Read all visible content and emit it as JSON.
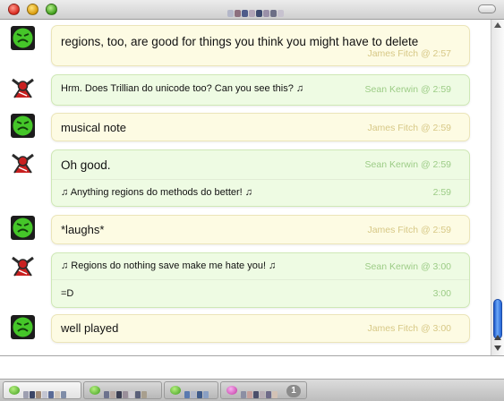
{
  "window": {
    "title_obscured": true
  },
  "messages": [
    {
      "sender": "James Fitch",
      "style": "outgoing",
      "avatar": "green-smiley-avatar",
      "lines": [
        {
          "text": "regions, too, are good for things you think you might have to delete",
          "stamp": "James Fitch @ 2:57"
        }
      ]
    },
    {
      "sender": "Sean Kerwin",
      "style": "incoming",
      "avatar": "red-beast-avatar",
      "lines": [
        {
          "text": "Hrm.  Does Trillian do unicode too?  Can you see this? ♫",
          "stamp": "Sean Kerwin @ 2:59"
        }
      ]
    },
    {
      "sender": "James Fitch",
      "style": "outgoing",
      "avatar": "green-smiley-avatar",
      "lines": [
        {
          "text": "musical note",
          "stamp": "James Fitch @ 2:59"
        }
      ]
    },
    {
      "sender": "Sean Kerwin",
      "style": "incoming",
      "avatar": "red-beast-avatar",
      "lines": [
        {
          "text": "Oh good.",
          "stamp": "Sean Kerwin @ 2:59"
        },
        {
          "text": "♫ Anything regions do methods do better! ♫",
          "stamp": "2:59"
        }
      ]
    },
    {
      "sender": "James Fitch",
      "style": "outgoing",
      "avatar": "green-smiley-avatar",
      "lines": [
        {
          "text": "*laughs*",
          "stamp": "James Fitch @ 2:59"
        }
      ]
    },
    {
      "sender": "Sean Kerwin",
      "style": "incoming",
      "avatar": "red-beast-avatar",
      "lines": [
        {
          "text": "♫ Regions do nothing save make me hate you! ♫",
          "stamp": "Sean Kerwin @ 3:00"
        },
        {
          "text": "=D",
          "stamp": "3:00"
        }
      ]
    },
    {
      "sender": "James Fitch",
      "style": "outgoing",
      "avatar": "green-smiley-avatar",
      "lines": [
        {
          "text": "well played",
          "stamp": "James Fitch @ 3:00"
        }
      ]
    }
  ],
  "input": {
    "value": "",
    "placeholder": ""
  },
  "tabs": [
    {
      "icon": "green-bubble-icon",
      "active": true
    },
    {
      "icon": "green-bubble-icon",
      "active": false
    },
    {
      "icon": "green-bubble-icon",
      "active": false
    },
    {
      "icon": "pink-bubble-icon",
      "active": false,
      "badge": "1"
    }
  ],
  "colors": {
    "outgoing_bubble": "#fdfbe3",
    "incoming_bubble": "#eefbe3",
    "outgoing_stamp": "#d7c886",
    "incoming_stamp": "#9ccc86",
    "scroll_thumb": "#2f6fdc"
  }
}
